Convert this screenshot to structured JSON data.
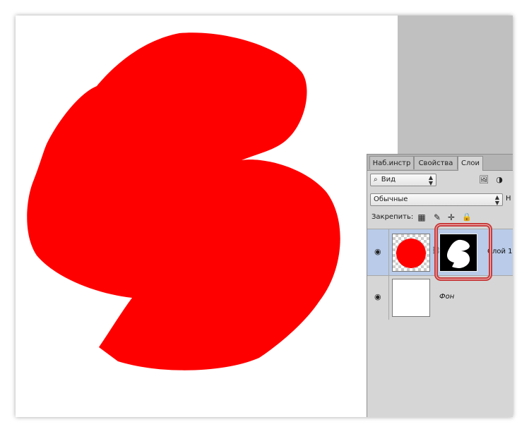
{
  "panel": {
    "tabs": [
      {
        "label": "Наб.инстр"
      },
      {
        "label": "Свойства"
      },
      {
        "label": "Слои"
      }
    ],
    "search": {
      "icon": "search-icon",
      "kind_label": "Вид"
    },
    "blend_mode": {
      "label": "Обычные",
      "opacity_prefix": "Н"
    },
    "lock": {
      "label": "Закрепить:"
    },
    "layers": [
      {
        "name": "Слой 1",
        "has_mask": true,
        "selected": true
      },
      {
        "name": "Фон",
        "has_mask": false,
        "selected": false
      }
    ]
  },
  "colors": {
    "shape_fill": "#ff0000",
    "canvas_bg": "#ffffff",
    "workspace_bg": "#c0c0c0",
    "panel_bg": "#d6d6d6",
    "selected_row": "#b9cbe8",
    "highlight_outline": "#c83b3b"
  }
}
